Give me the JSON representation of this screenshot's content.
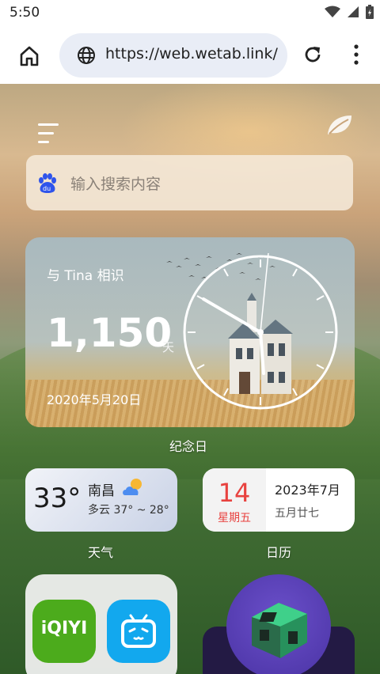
{
  "status_bar": {
    "time": "5:50"
  },
  "browser": {
    "url": "https://web.wetab.link/"
  },
  "search": {
    "placeholder": "输入搜索内容"
  },
  "anniversary": {
    "title": "与 Tina 相识",
    "count": "1,150",
    "unit": "天",
    "date": "2020年5月20日",
    "label": "纪念日"
  },
  "weather": {
    "temp": "33°",
    "city": "南昌",
    "condition": "多云 37° ~ 28°",
    "label": "天气"
  },
  "calendar": {
    "day": "14",
    "weekday": "星期五",
    "year_month": "2023年7月",
    "lunar": "五月廿七",
    "label": "日历"
  },
  "apps": {
    "iqiyi": "iQIYI"
  },
  "colors": {
    "calendar_red": "#e8423f",
    "iqiyi_green": "#4cab1c",
    "bilibili_blue": "#12a8ee"
  }
}
